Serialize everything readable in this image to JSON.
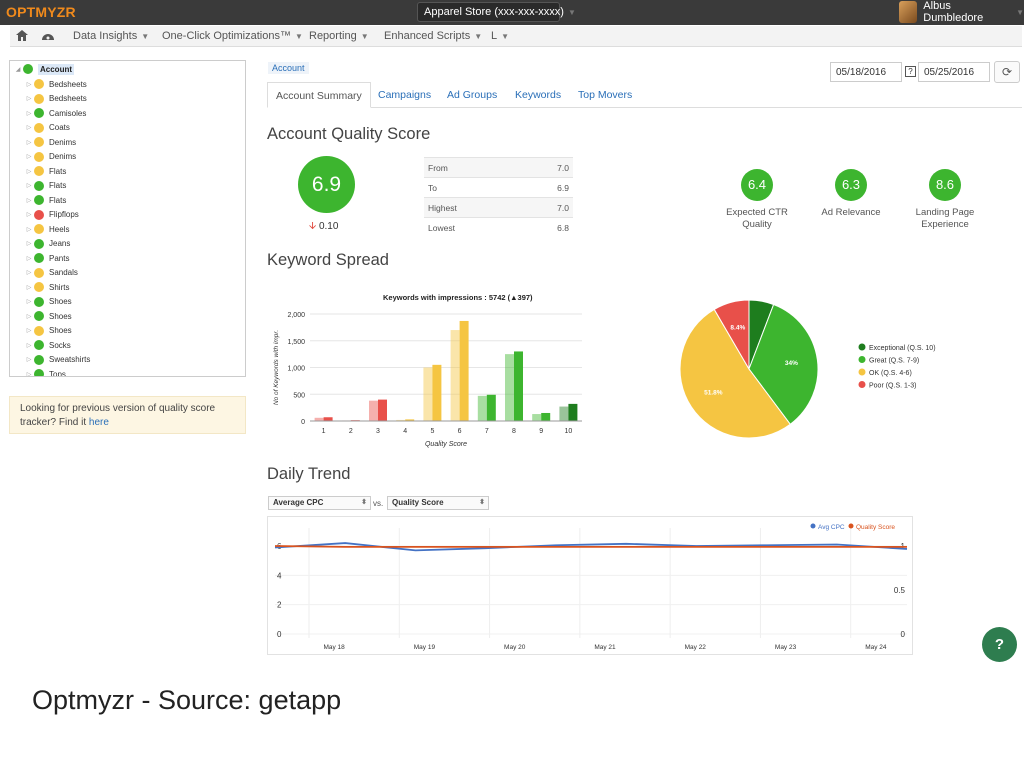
{
  "app": {
    "logo": "OPTMYZR",
    "account_select": "Apparel Store (xxx-xxx-xxxx)",
    "user_name": "Albus Dumbledore"
  },
  "menu": {
    "home_icon": "home-icon",
    "dashboard_icon": "dashboard-icon",
    "items": [
      {
        "label": "Data Insights"
      },
      {
        "label": "One-Click Optimizations™"
      },
      {
        "label": "Reporting"
      },
      {
        "label": "Enhanced Scripts"
      },
      {
        "label": "L"
      }
    ]
  },
  "tree": {
    "root": "Account",
    "root_color": "#3db52f",
    "items": [
      {
        "label": "Bedsheets",
        "color": "#f5c542"
      },
      {
        "label": "Bedsheets",
        "color": "#f5c542"
      },
      {
        "label": "Camisoles",
        "color": "#3db52f"
      },
      {
        "label": "Coats",
        "color": "#f5c542"
      },
      {
        "label": "Denims",
        "color": "#f5c542"
      },
      {
        "label": "Denims",
        "color": "#f5c542"
      },
      {
        "label": "Flats",
        "color": "#f5c542"
      },
      {
        "label": "Flats",
        "color": "#3db52f"
      },
      {
        "label": "Flats",
        "color": "#3db52f"
      },
      {
        "label": "Flipflops",
        "color": "#e8504a"
      },
      {
        "label": "Heels",
        "color": "#f5c542"
      },
      {
        "label": "Jeans",
        "color": "#3db52f"
      },
      {
        "label": "Pants",
        "color": "#3db52f"
      },
      {
        "label": "Sandals",
        "color": "#f5c542"
      },
      {
        "label": "Shirts",
        "color": "#f5c542"
      },
      {
        "label": "Shoes",
        "color": "#3db52f"
      },
      {
        "label": "Shoes",
        "color": "#3db52f"
      },
      {
        "label": "Shoes",
        "color": "#f5c542"
      },
      {
        "label": "Socks",
        "color": "#3db52f"
      },
      {
        "label": "Sweatshirts",
        "color": "#3db52f"
      },
      {
        "label": "Tops",
        "color": "#3db52f"
      }
    ]
  },
  "notice": {
    "text": "Looking for previous version of quality score tracker? Find it ",
    "link": "here"
  },
  "breadcrumb": "Account",
  "tabs": [
    {
      "label": "Account Summary"
    },
    {
      "label": "Campaigns"
    },
    {
      "label": "Ad Groups"
    },
    {
      "label": "Keywords"
    },
    {
      "label": "Top Movers"
    }
  ],
  "dates": {
    "from": "05/18/2016",
    "to": "05/25/2016",
    "calendar_icon": "calendar-icon",
    "refresh_icon": "refresh-icon"
  },
  "quality": {
    "heading": "Account Quality Score",
    "score": "6.9",
    "delta": "0.10",
    "table": [
      {
        "label": "From",
        "value": "7.0"
      },
      {
        "label": "To",
        "value": "6.9"
      },
      {
        "label": "Highest",
        "value": "7.0"
      },
      {
        "label": "Lowest",
        "value": "6.8"
      }
    ],
    "components": [
      {
        "score": "6.4",
        "label": "Expected CTR Quality"
      },
      {
        "score": "6.3",
        "label": "Ad Relevance"
      },
      {
        "score": "8.6",
        "label": "Landing Page Experience"
      }
    ]
  },
  "spread_heading": "Keyword Spread",
  "trend": {
    "heading": "Daily Trend",
    "select_left": "Average CPC",
    "vs": "vs.",
    "select_right": "Quality Score"
  },
  "caption": "Optmyzr - Source: getapp",
  "chart_data": [
    {
      "type": "bar",
      "title": "Keywords with impressions : 5742 (▲397)",
      "xlabel": "Quality Score",
      "ylabel": "No of Keywords with impr.",
      "categories": [
        "1",
        "2",
        "3",
        "4",
        "5",
        "6",
        "7",
        "8",
        "9",
        "10"
      ],
      "ylim": [
        0,
        2000
      ],
      "yticks": [
        0,
        500,
        1000,
        1500,
        2000
      ],
      "series": [
        {
          "values": [
            60,
            10,
            380,
            20,
            1000,
            1700,
            470,
            1250,
            130,
            270
          ]
        },
        {
          "values": [
            70,
            15,
            400,
            30,
            1050,
            1870,
            490,
            1300,
            150,
            320
          ]
        }
      ],
      "colors": [
        "#e8504a",
        "#e8504a",
        "#e8504a",
        "#f5c542",
        "#f5c542",
        "#f5c542",
        "#3db52f",
        "#3db52f",
        "#3db52f",
        "#1e7d1e"
      ]
    },
    {
      "type": "pie",
      "slices": [
        {
          "label": "Exceptional (Q.S. 10)",
          "value": 5.8,
          "color": "#1e7d1e"
        },
        {
          "label": "Great (Q.S. 7-9)",
          "value": 34,
          "display": "34%",
          "color": "#3db52f"
        },
        {
          "label": "OK (Q.S. 4-6)",
          "value": 51.8,
          "display": "51.8%",
          "color": "#f5c542"
        },
        {
          "label": "Poor (Q.S. 1-3)",
          "value": 8.4,
          "display": "8.4%",
          "color": "#e8504a"
        }
      ]
    },
    {
      "type": "line",
      "x": [
        "May 18",
        "May 19",
        "May 20",
        "May 21",
        "May 22",
        "May 23",
        "May 24"
      ],
      "y_left_ticks": [
        "0",
        "2",
        "4",
        "6"
      ],
      "y_right_ticks": [
        "0",
        "0.5",
        "1"
      ],
      "grid": true,
      "legend": "top-right",
      "series": [
        {
          "name": "Avg CPC",
          "color": "#4472c4",
          "axis": "left",
          "values": [
            5.9,
            6.2,
            5.7,
            5.85,
            6.05,
            6.15,
            6.0,
            6.05,
            6.1,
            5.8
          ]
        },
        {
          "name": "Quality Score",
          "color": "#d9531e",
          "axis": "right",
          "values": [
            1.0,
            0.99,
            0.99,
            0.99,
            0.99,
            0.99,
            0.99,
            0.99,
            0.99,
            0.99
          ]
        }
      ]
    }
  ]
}
